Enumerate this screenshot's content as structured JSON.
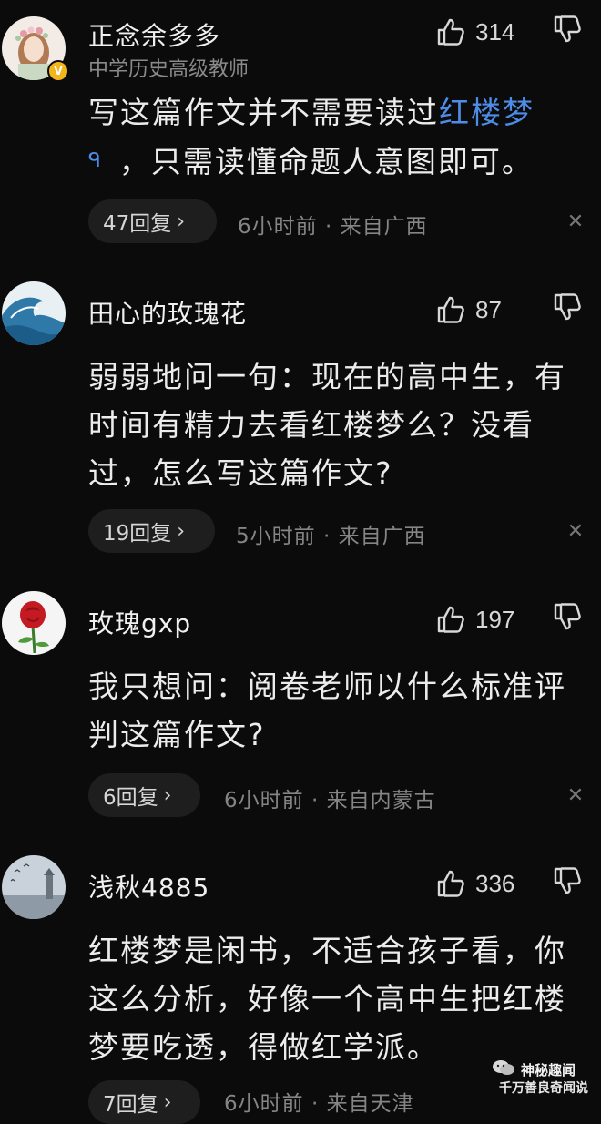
{
  "comments": [
    {
      "username": "正念余多多",
      "user_title": "中学历史高级教师",
      "verified_badge": "V",
      "likes": "314",
      "text_before": "写这篇作文并不需要读过",
      "link_text": "红楼梦",
      "search_mark": "ᑫ",
      "text_after": "，只需读懂命题人意图即可。",
      "replies": "47回复",
      "meta": "6小时前 · 来自广西",
      "avatar": "girl-flower-avatar"
    },
    {
      "username": "田心的玫瑰花",
      "likes": "87",
      "text": "弱弱地问一句：现在的高中生，有时间有精力去看红楼梦么？没看过，怎么写这篇作文?",
      "replies": "19回复",
      "meta": "5小时前 · 来自广西",
      "avatar": "wave-avatar"
    },
    {
      "username": "玫瑰gxp",
      "likes": "197",
      "text": "我只想问：阅卷老师以什么标准评判这篇作文?",
      "replies": "6回复",
      "meta": "6小时前 · 来自内蒙古",
      "avatar": "rose-avatar"
    },
    {
      "username": "浅秋4885",
      "likes": "336",
      "text": "红楼梦是闲书，不适合孩子看，你这么分析，好像一个高中生把红楼梦要吃透，得做红学派。",
      "replies": "7回复",
      "meta": "6小时前 · 来自天津",
      "avatar": "lighthouse-avatar"
    }
  ],
  "icons": {
    "like": "thumbs-up-icon",
    "dislike": "thumbs-down-icon",
    "close": "close-icon",
    "chevron": "chevron-right-icon"
  },
  "glyphs": {
    "chevron": "›",
    "close": "✕"
  },
  "watermark": {
    "line1": "神秘趣闻",
    "line2": "千万善良奇闻说"
  },
  "colors": {
    "link": "#4d8de8",
    "background": "#0b0b0b",
    "badge": "#f2b51c"
  }
}
